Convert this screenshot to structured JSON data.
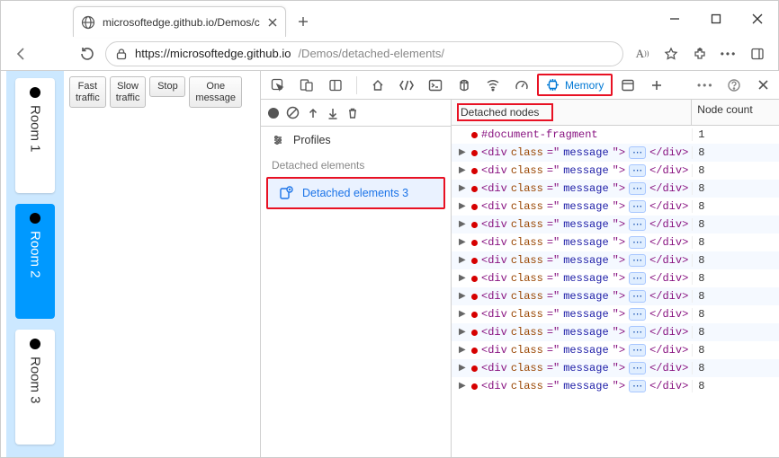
{
  "window": {
    "tab_title": "microsoftedge.github.io/Demos/c",
    "url_host": "https://microsoftedge.github.io",
    "url_path": "/Demos/detached-elements/"
  },
  "page": {
    "rooms": [
      {
        "label": "Room 1",
        "selected": false
      },
      {
        "label": "Room 2",
        "selected": true
      },
      {
        "label": "Room 3",
        "selected": false
      }
    ],
    "buttons": {
      "fast": "Fast\ntraffic",
      "slow": "Slow\ntraffic",
      "stop": "Stop",
      "one": "One\nmessage"
    }
  },
  "devtools": {
    "memory_tab": "Memory",
    "sidebar": {
      "profiles": "Profiles",
      "detached_heading": "Detached elements",
      "detached_item": "Detached elements 3"
    },
    "grid": {
      "header_nodes": "Detached nodes",
      "header_count": "Node count",
      "fragment_label": "#document-fragment",
      "fragment_count": "1",
      "row_count": "8",
      "rows": 14,
      "elem": "div",
      "attr_name": "class",
      "attr_val": "message",
      "ellipsis": "⋯"
    }
  }
}
